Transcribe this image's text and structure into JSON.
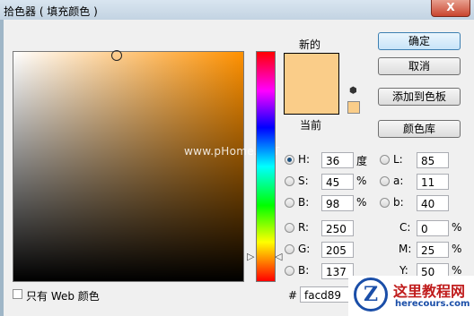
{
  "window": {
    "title": "拾色器 ( 填充颜色 )",
    "close_glyph": "X"
  },
  "picker": {
    "new_label": "新的",
    "current_label": "当前",
    "new_color": "#facd89",
    "current_color": "#facd89"
  },
  "buttons": {
    "ok": "确定",
    "cancel": "取消",
    "add_swatch": "添加到色板",
    "color_library": "颜色库"
  },
  "hsb": {
    "h": {
      "label": "H:",
      "value": "36",
      "unit": "度"
    },
    "s": {
      "label": "S:",
      "value": "45",
      "unit": "%"
    },
    "b": {
      "label": "B:",
      "value": "98",
      "unit": "%"
    }
  },
  "rgb": {
    "r": {
      "label": "R:",
      "value": "250"
    },
    "g": {
      "label": "G:",
      "value": "205"
    },
    "b": {
      "label": "B:",
      "value": "137"
    }
  },
  "lab": {
    "l": {
      "label": "L:",
      "value": "85"
    },
    "a": {
      "label": "a:",
      "value": "11"
    },
    "b": {
      "label": "b:",
      "value": "40"
    }
  },
  "cmyk": {
    "c": {
      "label": "C:",
      "value": "0",
      "unit": "%"
    },
    "m": {
      "label": "M:",
      "value": "25",
      "unit": "%"
    },
    "y": {
      "label": "Y:",
      "value": "50",
      "unit": "%"
    }
  },
  "hex": {
    "label": "#",
    "value": "facd89"
  },
  "web_only": {
    "label": "只有 Web 颜色",
    "checked": false
  },
  "watermark": "www.pHome.NET",
  "logo": {
    "mark": "Z",
    "text": "这里教程网",
    "url": "herecours.com"
  }
}
